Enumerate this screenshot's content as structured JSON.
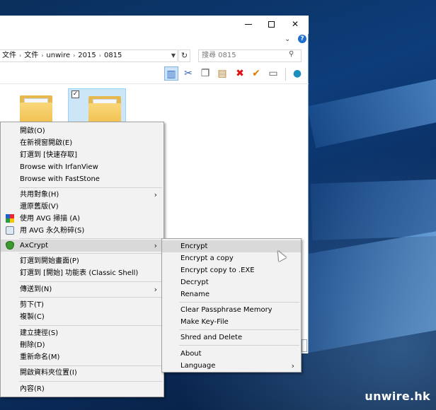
{
  "window": {
    "address_segments": [
      "文件",
      "文件",
      "unwire",
      "2015",
      "0815"
    ],
    "search_placeholder": "搜尋 0815"
  },
  "context_menu": {
    "items": [
      {
        "label": "開啟(O)"
      },
      {
        "label": "在新視窗開啟(E)"
      },
      {
        "label": "釘選到 [快速存取]"
      },
      {
        "label": "Browse with IrfanView"
      },
      {
        "label": "Browse with FastStone"
      },
      {
        "label": "共用對象(H)"
      },
      {
        "label": "還原舊版(V)"
      },
      {
        "label": "使用 AVG 掃描 (A)"
      },
      {
        "label": "用 AVG 永久粉碎(S)"
      },
      {
        "label": "AxCrypt"
      },
      {
        "label": "釘選到開始畫面(P)"
      },
      {
        "label": "釘選到 [開始] 功能表 (Classic Shell)"
      },
      {
        "label": "傳送到(N)"
      },
      {
        "label": "剪下(T)"
      },
      {
        "label": "複製(C)"
      },
      {
        "label": "建立捷徑(S)"
      },
      {
        "label": "刪除(D)"
      },
      {
        "label": "重新命名(M)"
      },
      {
        "label": "開啟資料夾位置(I)"
      },
      {
        "label": "內容(R)"
      }
    ]
  },
  "axcrypt_submenu": {
    "items": [
      {
        "label": "Encrypt"
      },
      {
        "label": "Encrypt a copy"
      },
      {
        "label": "Encrypt copy to .EXE"
      },
      {
        "label": "Decrypt"
      },
      {
        "label": "Rename"
      },
      {
        "label": "Clear Passphrase Memory"
      },
      {
        "label": "Make Key-File"
      },
      {
        "label": "Shred and Delete"
      },
      {
        "label": "About"
      },
      {
        "label": "Language"
      }
    ]
  },
  "watermark": "unwire.hk",
  "icons": {
    "toolbar": [
      "layout-icon",
      "cut-icon",
      "copy-icon",
      "paste-icon",
      "delete-icon",
      "check-icon",
      "rename-icon",
      "globe-icon"
    ],
    "menu": [
      "avg-scan-icon",
      "avg-shred-icon",
      "axcrypt-icon"
    ]
  }
}
